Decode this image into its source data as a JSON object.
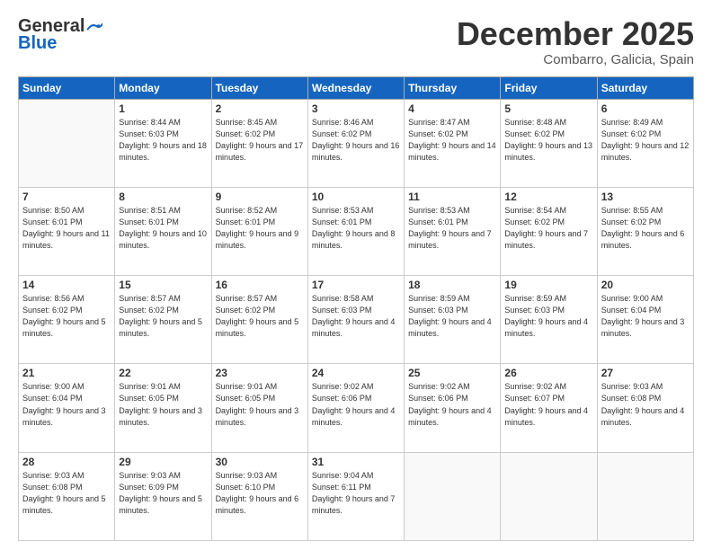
{
  "header": {
    "logo_general": "General",
    "logo_blue": "Blue",
    "month": "December 2025",
    "location": "Combarro, Galicia, Spain"
  },
  "weekdays": [
    "Sunday",
    "Monday",
    "Tuesday",
    "Wednesday",
    "Thursday",
    "Friday",
    "Saturday"
  ],
  "weeks": [
    [
      {
        "day": "",
        "sunrise": "",
        "sunset": "",
        "daylight": ""
      },
      {
        "day": "1",
        "sunrise": "Sunrise: 8:44 AM",
        "sunset": "Sunset: 6:03 PM",
        "daylight": "Daylight: 9 hours and 18 minutes."
      },
      {
        "day": "2",
        "sunrise": "Sunrise: 8:45 AM",
        "sunset": "Sunset: 6:02 PM",
        "daylight": "Daylight: 9 hours and 17 minutes."
      },
      {
        "day": "3",
        "sunrise": "Sunrise: 8:46 AM",
        "sunset": "Sunset: 6:02 PM",
        "daylight": "Daylight: 9 hours and 16 minutes."
      },
      {
        "day": "4",
        "sunrise": "Sunrise: 8:47 AM",
        "sunset": "Sunset: 6:02 PM",
        "daylight": "Daylight: 9 hours and 14 minutes."
      },
      {
        "day": "5",
        "sunrise": "Sunrise: 8:48 AM",
        "sunset": "Sunset: 6:02 PM",
        "daylight": "Daylight: 9 hours and 13 minutes."
      },
      {
        "day": "6",
        "sunrise": "Sunrise: 8:49 AM",
        "sunset": "Sunset: 6:02 PM",
        "daylight": "Daylight: 9 hours and 12 minutes."
      }
    ],
    [
      {
        "day": "7",
        "sunrise": "Sunrise: 8:50 AM",
        "sunset": "Sunset: 6:01 PM",
        "daylight": "Daylight: 9 hours and 11 minutes."
      },
      {
        "day": "8",
        "sunrise": "Sunrise: 8:51 AM",
        "sunset": "Sunset: 6:01 PM",
        "daylight": "Daylight: 9 hours and 10 minutes."
      },
      {
        "day": "9",
        "sunrise": "Sunrise: 8:52 AM",
        "sunset": "Sunset: 6:01 PM",
        "daylight": "Daylight: 9 hours and 9 minutes."
      },
      {
        "day": "10",
        "sunrise": "Sunrise: 8:53 AM",
        "sunset": "Sunset: 6:01 PM",
        "daylight": "Daylight: 9 hours and 8 minutes."
      },
      {
        "day": "11",
        "sunrise": "Sunrise: 8:53 AM",
        "sunset": "Sunset: 6:01 PM",
        "daylight": "Daylight: 9 hours and 7 minutes."
      },
      {
        "day": "12",
        "sunrise": "Sunrise: 8:54 AM",
        "sunset": "Sunset: 6:02 PM",
        "daylight": "Daylight: 9 hours and 7 minutes."
      },
      {
        "day": "13",
        "sunrise": "Sunrise: 8:55 AM",
        "sunset": "Sunset: 6:02 PM",
        "daylight": "Daylight: 9 hours and 6 minutes."
      }
    ],
    [
      {
        "day": "14",
        "sunrise": "Sunrise: 8:56 AM",
        "sunset": "Sunset: 6:02 PM",
        "daylight": "Daylight: 9 hours and 5 minutes."
      },
      {
        "day": "15",
        "sunrise": "Sunrise: 8:57 AM",
        "sunset": "Sunset: 6:02 PM",
        "daylight": "Daylight: 9 hours and 5 minutes."
      },
      {
        "day": "16",
        "sunrise": "Sunrise: 8:57 AM",
        "sunset": "Sunset: 6:02 PM",
        "daylight": "Daylight: 9 hours and 5 minutes."
      },
      {
        "day": "17",
        "sunrise": "Sunrise: 8:58 AM",
        "sunset": "Sunset: 6:03 PM",
        "daylight": "Daylight: 9 hours and 4 minutes."
      },
      {
        "day": "18",
        "sunrise": "Sunrise: 8:59 AM",
        "sunset": "Sunset: 6:03 PM",
        "daylight": "Daylight: 9 hours and 4 minutes."
      },
      {
        "day": "19",
        "sunrise": "Sunrise: 8:59 AM",
        "sunset": "Sunset: 6:03 PM",
        "daylight": "Daylight: 9 hours and 4 minutes."
      },
      {
        "day": "20",
        "sunrise": "Sunrise: 9:00 AM",
        "sunset": "Sunset: 6:04 PM",
        "daylight": "Daylight: 9 hours and 3 minutes."
      }
    ],
    [
      {
        "day": "21",
        "sunrise": "Sunrise: 9:00 AM",
        "sunset": "Sunset: 6:04 PM",
        "daylight": "Daylight: 9 hours and 3 minutes."
      },
      {
        "day": "22",
        "sunrise": "Sunrise: 9:01 AM",
        "sunset": "Sunset: 6:05 PM",
        "daylight": "Daylight: 9 hours and 3 minutes."
      },
      {
        "day": "23",
        "sunrise": "Sunrise: 9:01 AM",
        "sunset": "Sunset: 6:05 PM",
        "daylight": "Daylight: 9 hours and 3 minutes."
      },
      {
        "day": "24",
        "sunrise": "Sunrise: 9:02 AM",
        "sunset": "Sunset: 6:06 PM",
        "daylight": "Daylight: 9 hours and 4 minutes."
      },
      {
        "day": "25",
        "sunrise": "Sunrise: 9:02 AM",
        "sunset": "Sunset: 6:06 PM",
        "daylight": "Daylight: 9 hours and 4 minutes."
      },
      {
        "day": "26",
        "sunrise": "Sunrise: 9:02 AM",
        "sunset": "Sunset: 6:07 PM",
        "daylight": "Daylight: 9 hours and 4 minutes."
      },
      {
        "day": "27",
        "sunrise": "Sunrise: 9:03 AM",
        "sunset": "Sunset: 6:08 PM",
        "daylight": "Daylight: 9 hours and 4 minutes."
      }
    ],
    [
      {
        "day": "28",
        "sunrise": "Sunrise: 9:03 AM",
        "sunset": "Sunset: 6:08 PM",
        "daylight": "Daylight: 9 hours and 5 minutes."
      },
      {
        "day": "29",
        "sunrise": "Sunrise: 9:03 AM",
        "sunset": "Sunset: 6:09 PM",
        "daylight": "Daylight: 9 hours and 5 minutes."
      },
      {
        "day": "30",
        "sunrise": "Sunrise: 9:03 AM",
        "sunset": "Sunset: 6:10 PM",
        "daylight": "Daylight: 9 hours and 6 minutes."
      },
      {
        "day": "31",
        "sunrise": "Sunrise: 9:04 AM",
        "sunset": "Sunset: 6:11 PM",
        "daylight": "Daylight: 9 hours and 7 minutes."
      },
      {
        "day": "",
        "sunrise": "",
        "sunset": "",
        "daylight": ""
      },
      {
        "day": "",
        "sunrise": "",
        "sunset": "",
        "daylight": ""
      },
      {
        "day": "",
        "sunrise": "",
        "sunset": "",
        "daylight": ""
      }
    ]
  ]
}
